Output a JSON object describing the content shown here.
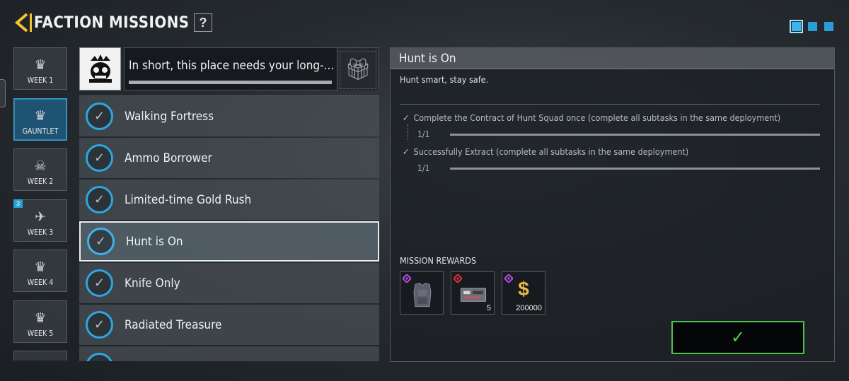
{
  "header": {
    "title": "FACTION MISSIONS",
    "help_label": "?"
  },
  "pager": {
    "pages": 3,
    "active": 1
  },
  "weeks": [
    {
      "label": "WEEK 1",
      "selected": false,
      "badge": ""
    },
    {
      "label": "GAUNTLET",
      "selected": true,
      "badge": ""
    },
    {
      "label": "WEEK 2",
      "selected": false,
      "badge": ""
    },
    {
      "label": "WEEK 3",
      "selected": false,
      "badge": "3"
    },
    {
      "label": "WEEK 4",
      "selected": false,
      "badge": ""
    },
    {
      "label": "WEEK 5",
      "selected": false,
      "badge": ""
    }
  ],
  "faction": {
    "quote": "In short, this place needs your long-..."
  },
  "missions": [
    {
      "name": "Walking Fortress",
      "completed": true,
      "selected": false
    },
    {
      "name": "Ammo Borrower",
      "completed": true,
      "selected": false
    },
    {
      "name": "Limited-time Gold Rush",
      "completed": true,
      "selected": false
    },
    {
      "name": "Hunt is On",
      "completed": true,
      "selected": true
    },
    {
      "name": "Knife Only",
      "completed": true,
      "selected": false
    },
    {
      "name": "Radiated Treasure",
      "completed": true,
      "selected": false
    }
  ],
  "detail": {
    "title": "Hunt is On",
    "description": "Hunt smart, stay safe.",
    "tasks": [
      {
        "text": "Complete the Contract of Hunt Squad once (complete all subtasks in the same deployment)",
        "progress": "1/1",
        "ratio": 1
      },
      {
        "text": "Successfully Extract (complete all subtasks in the same deployment)",
        "progress": "1/1",
        "ratio": 1
      }
    ],
    "rewards_title": "MISSION REWARDS",
    "rewards": [
      {
        "icon": "armor-vest-icon",
        "rarity_color": "#b04ee0",
        "quantity": ""
      },
      {
        "icon": "weapon-case-icon",
        "rarity_color": "#e0323a",
        "quantity": "5"
      },
      {
        "icon": "currency-icon",
        "rarity_color": "#b04ee0",
        "quantity": "200000"
      }
    ],
    "claim_icon": "checkmark-icon"
  },
  "colors": {
    "accent": "#2ea6e0",
    "claim_green": "#4cc24a",
    "back_yellow": "#f2c230"
  }
}
